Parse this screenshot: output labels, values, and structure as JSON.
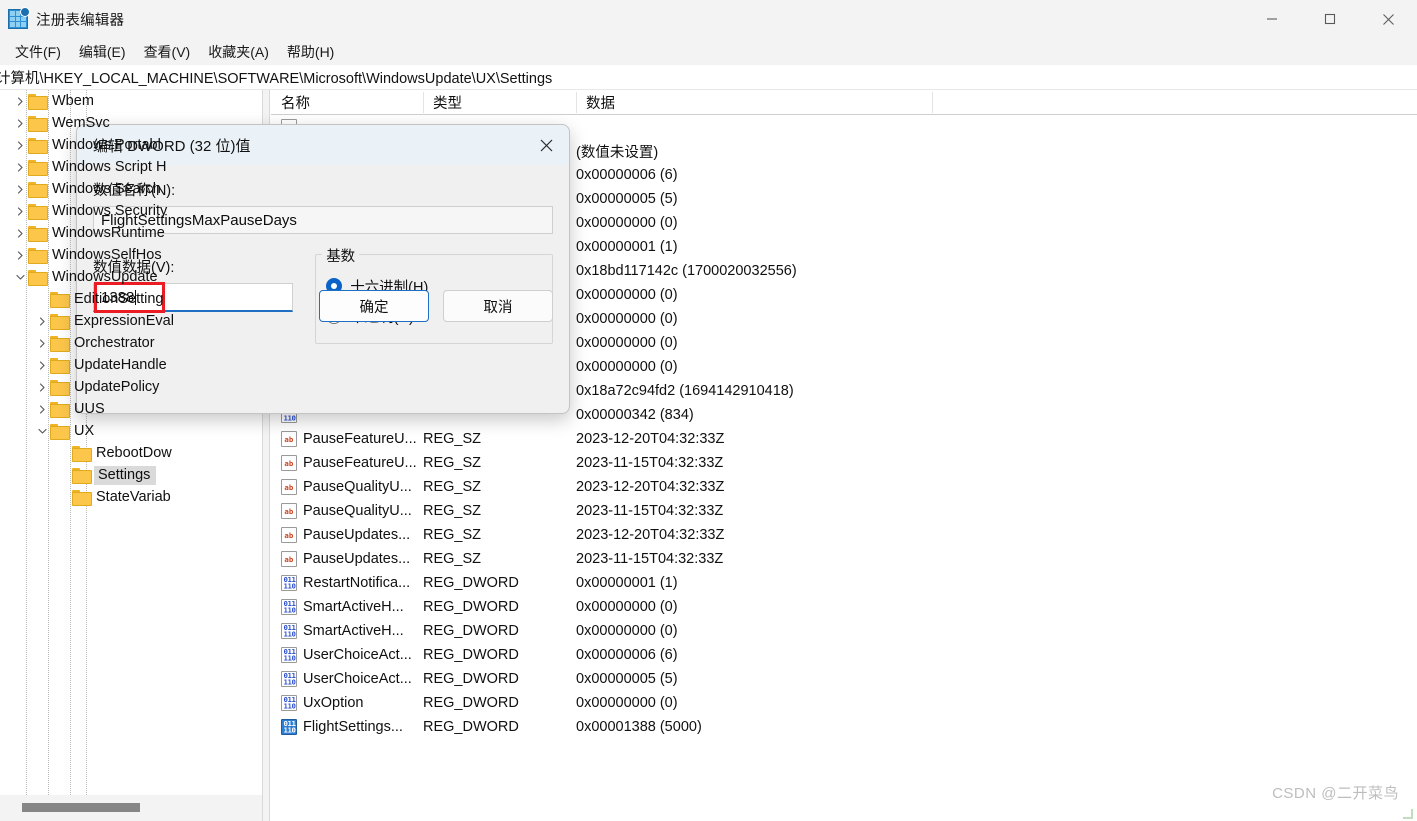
{
  "window": {
    "title": "注册表编辑器",
    "icon": "registry-icon",
    "minimize_label": "—",
    "maximize_label": "□",
    "close_label": "✕"
  },
  "menu": {
    "items": [
      {
        "label": "文件(F)"
      },
      {
        "label": "编辑(E)"
      },
      {
        "label": "查看(V)"
      },
      {
        "label": "收藏夹(A)"
      },
      {
        "label": "帮助(H)"
      }
    ]
  },
  "address": {
    "path": "计算机\\HKEY_LOCAL_MACHINE\\SOFTWARE\\Microsoft\\WindowsUpdate\\UX\\Settings"
  },
  "tree": {
    "items": [
      {
        "label": "Wbem",
        "indent": 3,
        "expander": "collapsed",
        "selected": false
      },
      {
        "label": "WemSvc",
        "indent": 3,
        "expander": "collapsed",
        "selected": false
      },
      {
        "label": "Windows Portabl",
        "indent": 3,
        "expander": "collapsed",
        "selected": false
      },
      {
        "label": "Windows Script H",
        "indent": 3,
        "expander": "collapsed",
        "selected": false
      },
      {
        "label": "Windows Search",
        "indent": 3,
        "expander": "collapsed",
        "selected": false
      },
      {
        "label": "Windows Security",
        "indent": 3,
        "expander": "collapsed",
        "selected": false
      },
      {
        "label": "WindowsRuntime",
        "indent": 3,
        "expander": "collapsed",
        "selected": false
      },
      {
        "label": "WindowsSelfHos",
        "indent": 3,
        "expander": "collapsed",
        "selected": false
      },
      {
        "label": "WindowsUpdate",
        "indent": 3,
        "expander": "expanded",
        "selected": false
      },
      {
        "label": "EditionSetting",
        "indent": 4,
        "expander": "none",
        "selected": false
      },
      {
        "label": "ExpressionEval",
        "indent": 4,
        "expander": "collapsed",
        "selected": false
      },
      {
        "label": "Orchestrator",
        "indent": 4,
        "expander": "collapsed",
        "selected": false
      },
      {
        "label": "UpdateHandle",
        "indent": 4,
        "expander": "collapsed",
        "selected": false
      },
      {
        "label": "UpdatePolicy",
        "indent": 4,
        "expander": "collapsed",
        "selected": false
      },
      {
        "label": "UUS",
        "indent": 4,
        "expander": "collapsed",
        "selected": false
      },
      {
        "label": "UX",
        "indent": 4,
        "expander": "expanded",
        "selected": false
      },
      {
        "label": "RebootDow",
        "indent": 5,
        "expander": "none",
        "selected": false
      },
      {
        "label": "Settings",
        "indent": 5,
        "expander": "none",
        "selected": true
      },
      {
        "label": "StateVariab",
        "indent": 5,
        "expander": "none",
        "selected": false
      }
    ]
  },
  "list": {
    "columns": [
      {
        "label": "名称"
      },
      {
        "label": "类型"
      },
      {
        "label": "数据"
      }
    ],
    "rows": [
      {
        "name": "",
        "type": "",
        "data": "",
        "icon": "reg-sz-icon",
        "selected": false
      },
      {
        "name": "",
        "type": "",
        "data": "(数值未设置)",
        "icon": "reg-sz-icon",
        "selected": false
      },
      {
        "name": "",
        "type": "",
        "data": "0x00000006 (6)",
        "icon": "reg-dword-icon",
        "selected": false
      },
      {
        "name": "",
        "type": "",
        "data": "0x00000005 (5)",
        "icon": "reg-dword-icon",
        "selected": false
      },
      {
        "name": "",
        "type": "",
        "data": "0x00000000 (0)",
        "icon": "reg-dword-icon",
        "selected": false
      },
      {
        "name": "",
        "type": "",
        "data": "0x00000001 (1)",
        "icon": "reg-dword-icon",
        "selected": false
      },
      {
        "name": "",
        "type": "",
        "data": "0x18bd117142c (1700020032556)",
        "icon": "reg-qword-icon",
        "selected": false
      },
      {
        "name": "",
        "type": "",
        "data": "0x00000000 (0)",
        "icon": "reg-dword-icon",
        "selected": false
      },
      {
        "name": "",
        "type": "",
        "data": "0x00000000 (0)",
        "icon": "reg-dword-icon",
        "selected": false
      },
      {
        "name": "",
        "type": "",
        "data": "0x00000000 (0)",
        "icon": "reg-dword-icon",
        "selected": false
      },
      {
        "name": "",
        "type": "",
        "data": "0x00000000 (0)",
        "icon": "reg-dword-icon",
        "selected": false
      },
      {
        "name": "",
        "type": "",
        "data": "0x18a72c94fd2 (1694142910418)",
        "icon": "reg-qword-icon",
        "selected": false
      },
      {
        "name": "",
        "type": "",
        "data": "0x00000342 (834)",
        "icon": "reg-dword-icon",
        "selected": false
      },
      {
        "name": "PauseFeatureU...",
        "type": "REG_SZ",
        "data": "2023-12-20T04:32:33Z",
        "icon": "reg-sz-icon",
        "selected": false
      },
      {
        "name": "PauseFeatureU...",
        "type": "REG_SZ",
        "data": "2023-11-15T04:32:33Z",
        "icon": "reg-sz-icon",
        "selected": false
      },
      {
        "name": "PauseQualityU...",
        "type": "REG_SZ",
        "data": "2023-12-20T04:32:33Z",
        "icon": "reg-sz-icon",
        "selected": false
      },
      {
        "name": "PauseQualityU...",
        "type": "REG_SZ",
        "data": "2023-11-15T04:32:33Z",
        "icon": "reg-sz-icon",
        "selected": false
      },
      {
        "name": "PauseUpdates...",
        "type": "REG_SZ",
        "data": "2023-12-20T04:32:33Z",
        "icon": "reg-sz-icon",
        "selected": false
      },
      {
        "name": "PauseUpdates...",
        "type": "REG_SZ",
        "data": "2023-11-15T04:32:33Z",
        "icon": "reg-sz-icon",
        "selected": false
      },
      {
        "name": "RestartNotifica...",
        "type": "REG_DWORD",
        "data": "0x00000001 (1)",
        "icon": "reg-dword-icon",
        "selected": false
      },
      {
        "name": "SmartActiveH...",
        "type": "REG_DWORD",
        "data": "0x00000000 (0)",
        "icon": "reg-dword-icon",
        "selected": false
      },
      {
        "name": "SmartActiveH...",
        "type": "REG_DWORD",
        "data": "0x00000000 (0)",
        "icon": "reg-dword-icon",
        "selected": false
      },
      {
        "name": "UserChoiceAct...",
        "type": "REG_DWORD",
        "data": "0x00000006 (6)",
        "icon": "reg-dword-icon",
        "selected": false
      },
      {
        "name": "UserChoiceAct...",
        "type": "REG_DWORD",
        "data": "0x00000005 (5)",
        "icon": "reg-dword-icon",
        "selected": false
      },
      {
        "name": "UxOption",
        "type": "REG_DWORD",
        "data": "0x00000000 (0)",
        "icon": "reg-dword-icon",
        "selected": false
      },
      {
        "name": "FlightSettings...",
        "type": "REG_DWORD",
        "data": "0x00001388 (5000)",
        "icon": "reg-dword-icon",
        "selected": true
      }
    ]
  },
  "dialog": {
    "title": "编辑 DWORD (32 位)值",
    "close_label": "✕",
    "name_label": "数值名称(N):",
    "name_value": "FlightSettingsMaxPauseDays",
    "data_label": "数值数据(V):",
    "data_value": "1388",
    "base_legend": "基数",
    "base_options": [
      {
        "label": "十六进制(H)",
        "checked": true
      },
      {
        "label": "十进制(D)",
        "checked": false
      }
    ],
    "ok_label": "确定",
    "cancel_label": "取消"
  },
  "watermark": {
    "text": "CSDN @二开菜鸟"
  },
  "colors": {
    "accent": "#1f6fc4",
    "highlight_box": "#ec1c24",
    "folder": "#fcc64a",
    "selection": "#dadada",
    "dialog_title_bg": "#eaf2f7"
  }
}
